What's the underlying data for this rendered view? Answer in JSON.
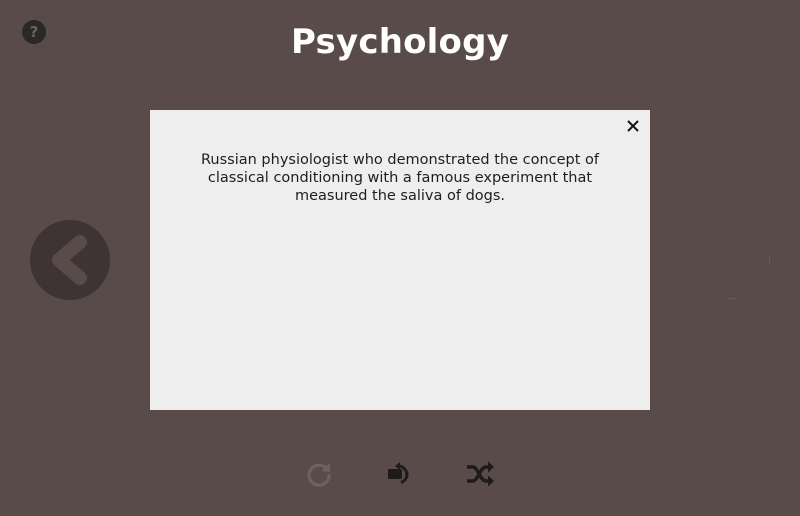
{
  "header": {
    "help_label": "?",
    "title": "Psychology"
  },
  "card": {
    "text": "Russian physiologist who demonstrated the concept of classical conditioning with a famous experiment that measured the saliva of dogs.",
    "close_icon": "close-icon"
  },
  "navigation": {
    "prev_icon": "chevron-left-icon"
  },
  "controls": [
    {
      "name": "restart",
      "icon": "restart-icon",
      "state": "disabled"
    },
    {
      "name": "flip",
      "icon": "flip-card-icon",
      "state": "enabled"
    },
    {
      "name": "shuffle",
      "icon": "shuffle-icon",
      "state": "enabled"
    }
  ],
  "colors": {
    "background": "#594b4a",
    "card": "#eeeeee",
    "dark_button": "#3d3433",
    "icon_active": "#1f1b1b",
    "icon_disabled": "#6c6262",
    "title": "#ffffff"
  }
}
